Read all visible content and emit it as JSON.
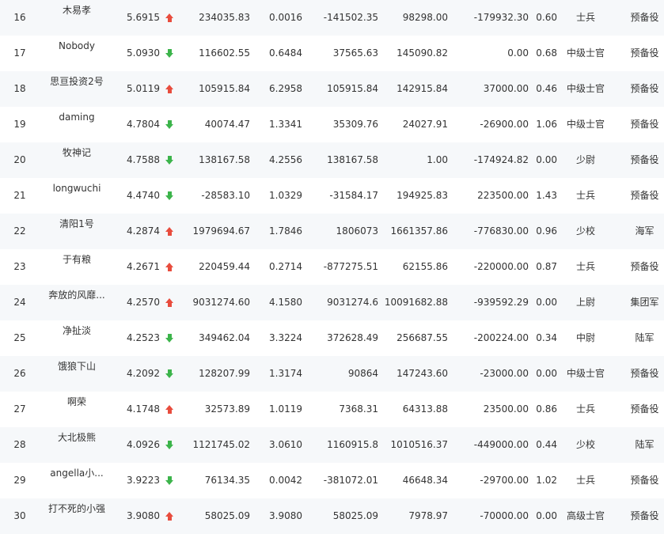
{
  "rows": [
    {
      "rank": "16",
      "name": "木易孝",
      "score": "5.6915",
      "trend": "up",
      "a": "234035.83",
      "b": "0.0016",
      "c": "-141502.35",
      "d": "98298.00",
      "e": "-179932.30",
      "f": "0.60",
      "rank_title": "士兵",
      "service": "预备役"
    },
    {
      "rank": "17",
      "name": "Nobody",
      "score": "5.0930",
      "trend": "down",
      "a": "116602.55",
      "b": "0.6484",
      "c": "37565.63",
      "d": "145090.82",
      "e": "0.00",
      "f": "0.68",
      "rank_title": "中级士官",
      "service": "预备役"
    },
    {
      "rank": "18",
      "name": "思亘投资2号",
      "score": "5.0119",
      "trend": "up",
      "a": "105915.84",
      "b": "6.2958",
      "c": "105915.84",
      "d": "142915.84",
      "e": "37000.00",
      "f": "0.46",
      "rank_title": "中级士官",
      "service": "预备役"
    },
    {
      "rank": "19",
      "name": "daming",
      "score": "4.7804",
      "trend": "down",
      "a": "40074.47",
      "b": "1.3341",
      "c": "35309.76",
      "d": "24027.91",
      "e": "-26900.00",
      "f": "1.06",
      "rank_title": "中级士官",
      "service": "预备役"
    },
    {
      "rank": "20",
      "name": "牧神记",
      "score": "4.7588",
      "trend": "down",
      "a": "138167.58",
      "b": "4.2556",
      "c": "138167.58",
      "d": "1.00",
      "e": "-174924.82",
      "f": "0.00",
      "rank_title": "少尉",
      "service": "预备役"
    },
    {
      "rank": "21",
      "name": "longwuchi",
      "score": "4.4740",
      "trend": "down",
      "a": "-28583.10",
      "b": "1.0329",
      "c": "-31584.17",
      "d": "194925.83",
      "e": "223500.00",
      "f": "1.43",
      "rank_title": "士兵",
      "service": "预备役"
    },
    {
      "rank": "22",
      "name": "清阳1号",
      "score": "4.2874",
      "trend": "up",
      "a": "1979694.67",
      "b": "1.7846",
      "c": "1806073",
      "d": "1661357.86",
      "e": "-776830.00",
      "f": "0.96",
      "rank_title": "少校",
      "service": "海军"
    },
    {
      "rank": "23",
      "name": "于有粮",
      "score": "4.2671",
      "trend": "up",
      "a": "220459.44",
      "b": "0.2714",
      "c": "-877275.51",
      "d": "62155.86",
      "e": "-220000.00",
      "f": "0.87",
      "rank_title": "士兵",
      "service": "预备役"
    },
    {
      "rank": "24",
      "name": "奔放的风靡...",
      "score": "4.2570",
      "trend": "up",
      "a": "9031274.60",
      "b": "4.1580",
      "c": "9031274.6",
      "d": "10091682.88",
      "e": "-939592.29",
      "f": "0.00",
      "rank_title": "上尉",
      "service": "集团军"
    },
    {
      "rank": "25",
      "name": "净扯淡",
      "score": "4.2523",
      "trend": "down",
      "a": "349462.04",
      "b": "3.3224",
      "c": "372628.49",
      "d": "256687.55",
      "e": "-200224.00",
      "f": "0.34",
      "rank_title": "中尉",
      "service": "陆军"
    },
    {
      "rank": "26",
      "name": "饿狼下山",
      "score": "4.2092",
      "trend": "down",
      "a": "128207.99",
      "b": "1.3174",
      "c": "90864",
      "d": "147243.60",
      "e": "-23000.00",
      "f": "0.00",
      "rank_title": "中级士官",
      "service": "预备役"
    },
    {
      "rank": "27",
      "name": "啊荣",
      "score": "4.1748",
      "trend": "up",
      "a": "32573.89",
      "b": "1.0119",
      "c": "7368.31",
      "d": "64313.88",
      "e": "23500.00",
      "f": "0.86",
      "rank_title": "士兵",
      "service": "预备役"
    },
    {
      "rank": "28",
      "name": "大北极熊",
      "score": "4.0926",
      "trend": "down",
      "a": "1121745.02",
      "b": "3.0610",
      "c": "1160915.8",
      "d": "1010516.37",
      "e": "-449000.00",
      "f": "0.44",
      "rank_title": "少校",
      "service": "陆军"
    },
    {
      "rank": "29",
      "name": "angella小...",
      "score": "3.9223",
      "trend": "down",
      "a": "76134.35",
      "b": "0.0042",
      "c": "-381072.01",
      "d": "46648.34",
      "e": "-29700.00",
      "f": "1.02",
      "rank_title": "士兵",
      "service": "预备役"
    },
    {
      "rank": "30",
      "name": "打不死的小强",
      "score": "3.9080",
      "trend": "up",
      "a": "58025.09",
      "b": "3.9080",
      "c": "58025.09",
      "d": "7978.97",
      "e": "-70000.00",
      "f": "0.00",
      "rank_title": "高级士官",
      "service": "预备役"
    }
  ],
  "colors": {
    "up": "#e84c3d",
    "down": "#3cb44b"
  }
}
